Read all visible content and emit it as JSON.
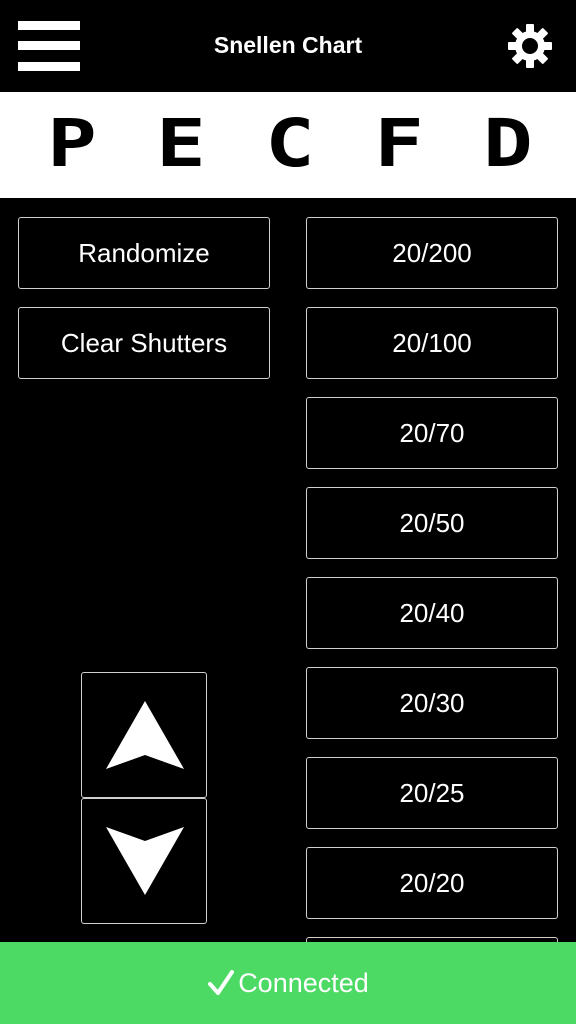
{
  "header": {
    "title": "Snellen Chart",
    "menu_icon": "hamburger-menu-icon",
    "settings_icon": "gear-icon"
  },
  "chart": {
    "letters": [
      "P",
      "E",
      "C",
      "F",
      "D"
    ]
  },
  "controls": {
    "randomize_label": "Randomize",
    "clear_label": "Clear Shutters",
    "up_icon": "arrow-up-icon",
    "down_icon": "arrow-down-icon"
  },
  "acuity_levels": [
    "20/200",
    "20/100",
    "20/70",
    "20/50",
    "20/40",
    "20/30",
    "20/25",
    "20/20"
  ],
  "status": {
    "text": "Connected",
    "icon": "checkmark-icon",
    "color": "#4cd964"
  }
}
